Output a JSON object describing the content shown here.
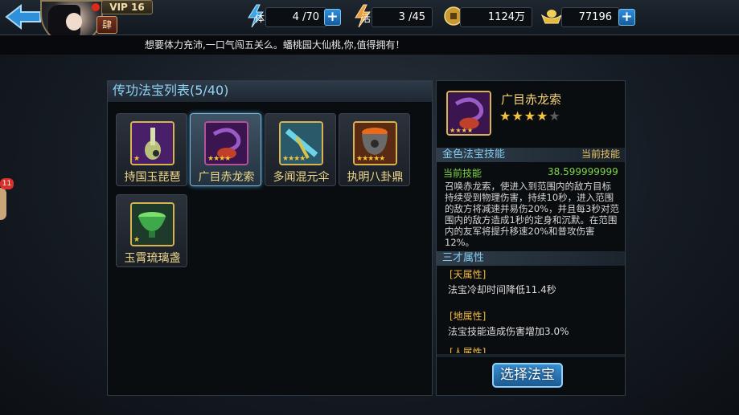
{
  "header": {
    "vip_label": "VIP 16",
    "rank_label": "肆",
    "stamina": {
      "label": "体",
      "value": "4 /70"
    },
    "vitality": {
      "label": "活",
      "value": "3 /45"
    },
    "coins": {
      "value": "1124万"
    },
    "ingots": {
      "value": "77196"
    }
  },
  "marquee": "想要体力充沛,一口气闯五关么。蟠桃园大仙桃,你,值得拥有！",
  "list_panel": {
    "title": "传功法宝列表(5/40)",
    "items": [
      {
        "name": "持国玉琵琶",
        "stars": 1,
        "stars_text": "★"
      },
      {
        "name": "广目赤龙索",
        "stars": 4,
        "stars_text": "★★★★",
        "selected": true
      },
      {
        "name": "多闻混元伞",
        "stars": 4,
        "stars_text": "★★★★"
      },
      {
        "name": "执明八卦鼎",
        "stars": 5,
        "stars_text": "★★★★★"
      },
      {
        "name": "玉霄琉璃盏",
        "stars": 1,
        "stars_text": "★"
      }
    ]
  },
  "detail": {
    "name": "广目赤龙索",
    "stars_on": "★★★★",
    "stars_off": "★",
    "rating": 4,
    "max_rating": 5,
    "skill_section": "金色法宝技能",
    "skill_section_right": "当前技能",
    "current_skill_label": "当前技能",
    "current_skill_value": "38.599999999",
    "skill_desc": "召唤赤龙索，使进入到范围内的敌方目标持续受到物理伤害，持续10秒，进入范围的敌方将减速并易伤20%，并且每3秒对范围内的敌方造成1秒的定身和沉默。在范围内的友军将提升移速20%和普攻伤害12%。",
    "attr_section": "三才属性",
    "attrs": [
      {
        "head": "[天属性]",
        "text": "法宝冷却时间降低11.4秒"
      },
      {
        "head": "[地属性]",
        "text": "法宝技能造成伤害增加3.0%"
      },
      {
        "head": "[人属性]",
        "text": ""
      }
    ]
  },
  "select_button": "选择法宝",
  "side_badge": "11",
  "colors": {
    "accent_blue": "#2f8fd9",
    "gold": "#f0d88a",
    "green": "#7fd34a",
    "orange": "#f0b93f"
  }
}
